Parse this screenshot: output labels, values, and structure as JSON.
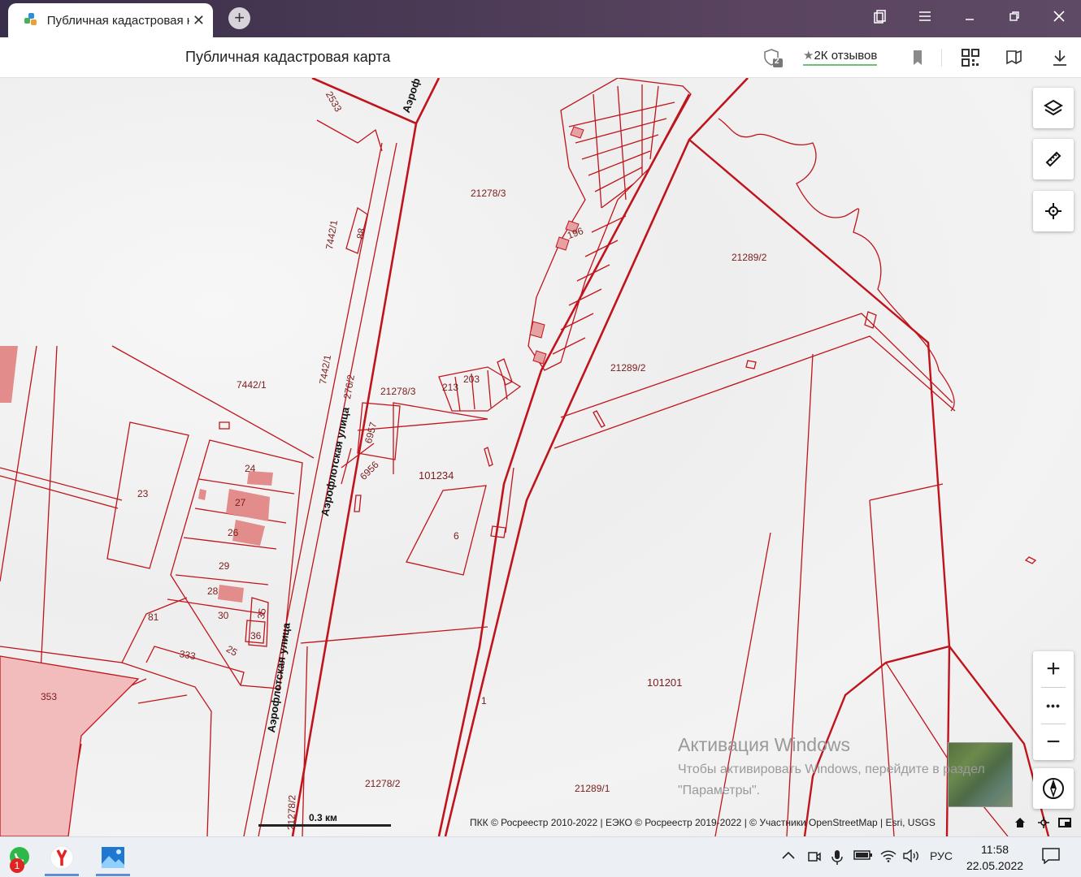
{
  "browser": {
    "tab_title": "Публичная кадастровая карта",
    "new_tab": "+",
    "tab_close": "✕"
  },
  "addressbar": {
    "page_title": "Публичная кадастровая карта",
    "shield_badge": "2",
    "reviews_star": "★",
    "reviews_label": "2К отзывов"
  },
  "map": {
    "parcel_labels": [
      "21278/3",
      "21289/2",
      "21289/2",
      "21278/3",
      "7442/1",
      "7442/1",
      "7442/1",
      "101234",
      "101201",
      "21278/2",
      "21289/1",
      "21278/2",
      "6957",
      "6956",
      "196",
      "213",
      "203",
      "24",
      "27",
      "26",
      "29",
      "28",
      "30",
      "35",
      "36",
      "25",
      "333",
      "81",
      "23",
      "353",
      "88",
      "6",
      "1",
      "2533",
      "276/2"
    ],
    "street_name": "Аэрофлотская улица",
    "street_partial": "Аэроф",
    "scale_label": "0.3 км",
    "attribution": "ПКК © Росреестр 2010-2022 | ЕЭКО © Росреестр 2019-2022 | © Участники OpenStreetMap | Esri, USGS",
    "zoom_in": "+",
    "zoom_more": "•••",
    "zoom_out": "−",
    "activation_title": "Активация Windows",
    "activation_text1": "Чтобы активировать Windows, перейдите в раздел",
    "activation_text2": "\"Параметры\"."
  },
  "taskbar": {
    "whatsapp_badge": "1",
    "language": "РУС",
    "time": "11:58",
    "date": "22.05.2022"
  },
  "colors": {
    "parcel_stroke": "#c0141c",
    "building_fill": "#e38c8c",
    "accent_green": "#6ebf7a"
  }
}
